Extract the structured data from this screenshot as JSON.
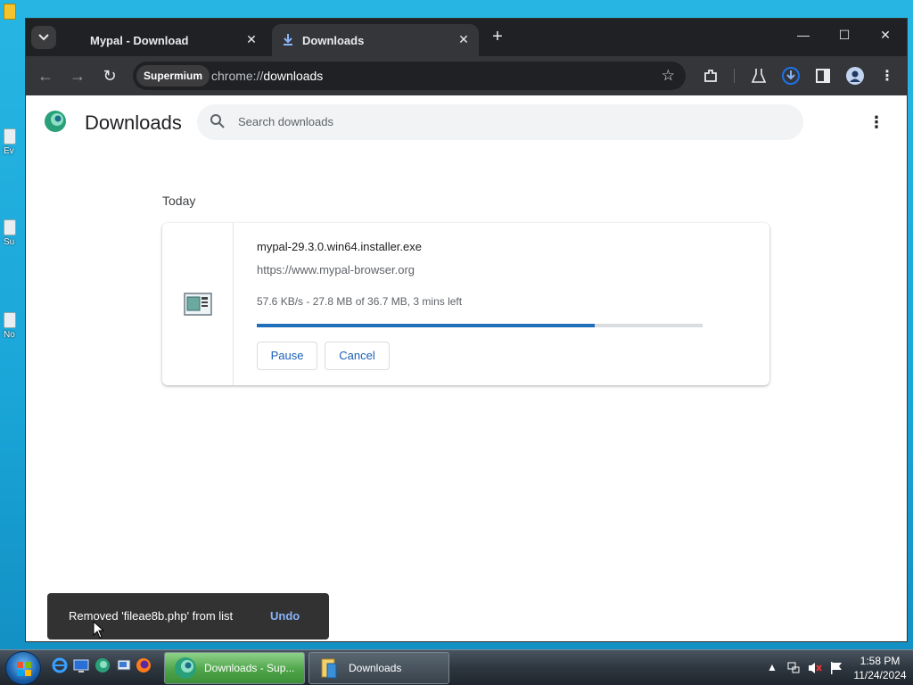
{
  "desktop": {
    "icons": [
      {
        "label": "Ev"
      },
      {
        "label": "Su"
      },
      {
        "label": "No"
      }
    ]
  },
  "browser": {
    "tabs": [
      {
        "title": "Mypal - Download",
        "active": false
      },
      {
        "title": "Downloads",
        "active": true
      }
    ],
    "profile_chip": "Supermium",
    "url_scheme": "chrome://",
    "url_path": "downloads"
  },
  "page": {
    "title": "Downloads",
    "search_placeholder": "Search downloads",
    "section_date": "Today",
    "download": {
      "filename": "mypal-29.3.0.win64.installer.exe",
      "source_url": "https://www.mypal-browser.org",
      "status": "57.6 KB/s - 27.8 MB of 36.7 MB, 3 mins left",
      "progress_percent": 75.7,
      "pause_label": "Pause",
      "cancel_label": "Cancel"
    },
    "toast": {
      "message": "Removed 'fileae8b.php' from list",
      "action": "Undo"
    }
  },
  "taskbar": {
    "buttons": [
      {
        "label": "Downloads - Sup..."
      },
      {
        "label": "Downloads"
      }
    ],
    "time": "1:58 PM",
    "date": "11/24/2024"
  },
  "colors": {
    "accent": "#1f6fb8",
    "tabbar_bg": "#202124",
    "toolbar_bg": "#35363a",
    "toast_bg": "#323232",
    "undo_color": "#8ab4f8"
  }
}
